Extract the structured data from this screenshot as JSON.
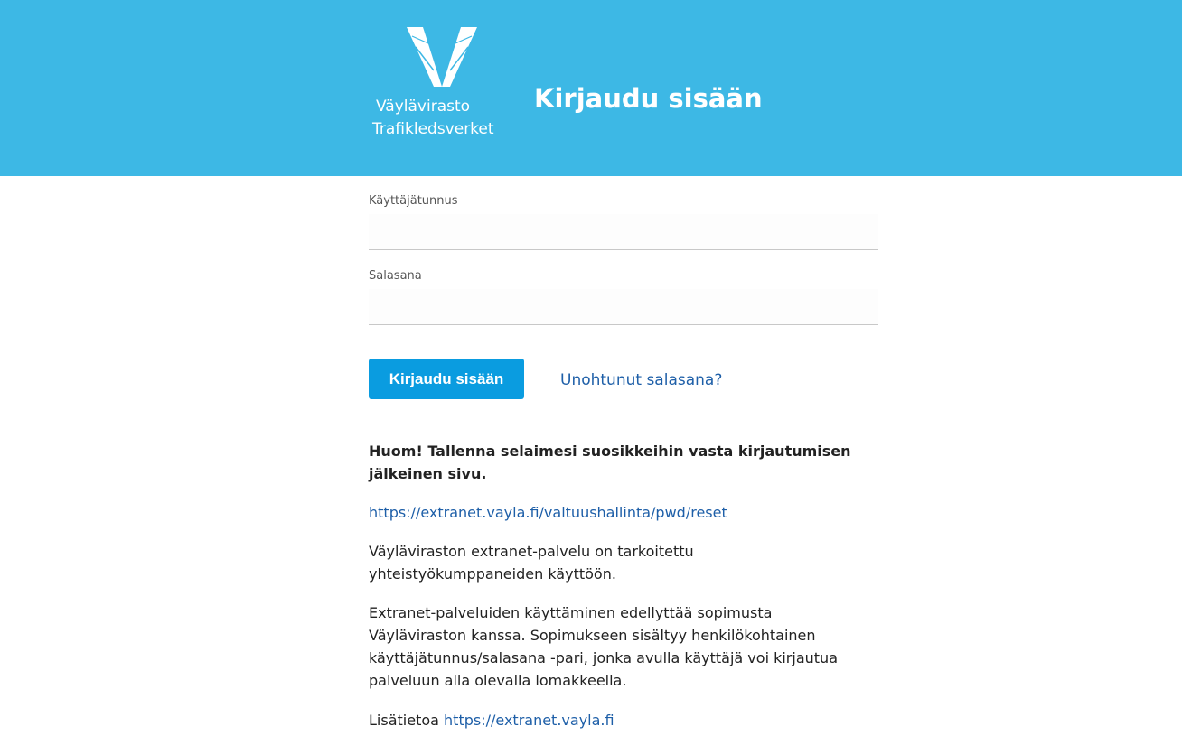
{
  "header": {
    "logo_line1": "Väylävirasto",
    "logo_line2": "Trafikledsverket",
    "title": "Kirjaudu sisään",
    "background": "#3db8e5"
  },
  "form": {
    "username_label": "Käyttäjätunnus",
    "username_value": "",
    "password_label": "Salasana",
    "password_value": "",
    "login_button": "Kirjaudu sisään",
    "forgot_link": "Unohtunut salasana?"
  },
  "info": {
    "notice": "Huom! Tallenna selaimesi suosikkeihin vasta kirjautumisen jälkeinen sivu.",
    "reset_link": "https://extranet.vayla.fi/valtuushallinta/pwd/reset",
    "para1": "Väyläviraston extranet-palvelu on tarkoitettu yhteistyökumppaneiden käyttöön.",
    "para2": "Extranet-palveluiden käyttäminen edellyttää sopimusta Väyläviraston kanssa. Sopimukseen sisältyy henkilökohtainen käyttäjätunnus/salasana -pari, jonka avulla käyttäjä voi kirjautua palveluun alla olevalla lomakkeella.",
    "more_prefix": "Lisätietoa",
    "more_link": "https://extranet.vayla.fi"
  },
  "colors": {
    "accent": "#3db8e5",
    "button": "#0a9ce0",
    "link": "#1e5fa8"
  }
}
